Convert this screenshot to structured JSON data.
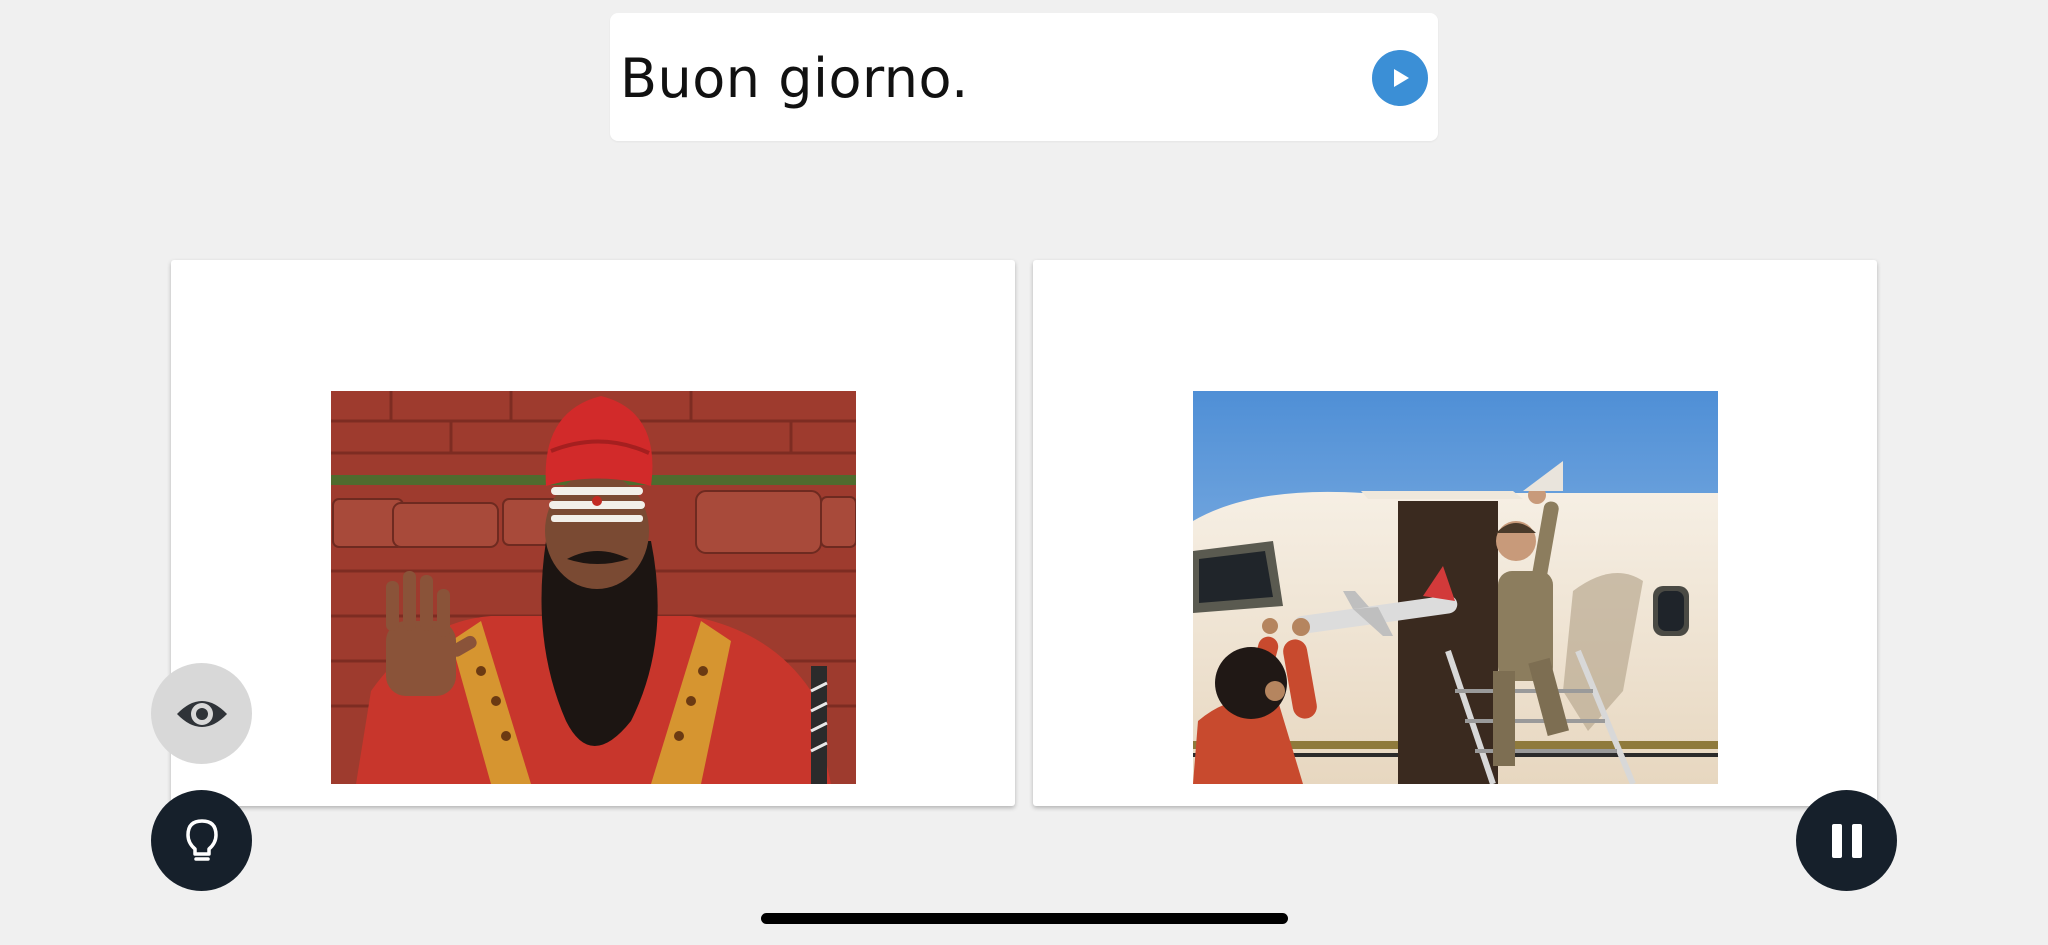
{
  "prompt": {
    "text": "Buon giorno."
  },
  "icons": {
    "play": "play-icon",
    "eye": "eye-icon",
    "hint": "lightbulb-icon",
    "pause": "pause-icon"
  },
  "colors": {
    "background": "#f0f0f0",
    "play_button": "#3b8fd6",
    "dark_button": "#16202b",
    "eye_button": "#d8d8d8"
  },
  "choices": [
    {
      "image": "man-with-turban-waving-photo"
    },
    {
      "image": "businessman-boarding-jet-photo"
    }
  ]
}
